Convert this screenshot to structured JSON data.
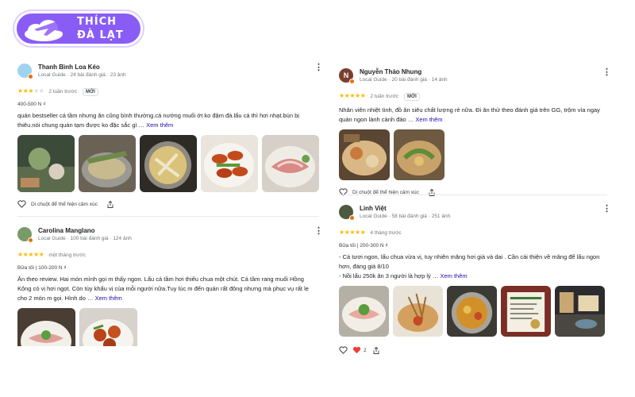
{
  "logo": {
    "line1": "THÍCH",
    "line2": "ĐÀ LẠT"
  },
  "see_more": "Xem thêm",
  "reviews": [
    {
      "name": "Thanh Bình Loa Kéo",
      "meta": "Local Guide · 24 bài đánh giá · 23 ảnh",
      "stars_on": "★★★",
      "stars_off": "★★",
      "ago": "2 tuần trước",
      "badge": "MỚI",
      "price": "400-500 N ₫",
      "text": "quán bestseller cá tầm nhưng ăn cũng bình thường.cá nướng muối ớt ko đậm đà.lẩu cá thì hơi nhạt.bún bị thiêu.nói chung quán tạm được ko đặc sắc gì …",
      "react": "Di chuột để thể hiện cảm xúc"
    },
    {
      "name": "Carolina Manglano",
      "meta": "Local Guide · 100 bài đánh giá · 124 ảnh",
      "stars_on": "★★★★★",
      "stars_off": "",
      "ago": "một tháng trước",
      "price": "Bữa tối  |  100-200 N ₫",
      "text": "Ăn theo review. Hai món mình gọi m thấy ngon. Lẩu cá tầm hơi thiếu chua một chút. Cá tầm rang muối Hồng Kông có vị hơi ngọt. Còn tùy khẩu vị của mỗi người nữa.Tuy lúc m đến quán rất đông nhưng mà phục vụ rất lẹ cho 2 món m gọi. Hình do …"
    },
    {
      "name": "Nguyễn Thảo Nhung",
      "meta": "Local Guide · 20 bài đánh giá · 14 ảnh",
      "avatar_letter": "N",
      "stars_on": "★★★★★",
      "stars_off": "",
      "ago": "2 tuần trước",
      "badge": "MỚI",
      "text": "Nhân viên nhiệt tình, đồ ăn siêu chất lượng rẻ nữa. Đi ăn thử theo đánh giá trên GG, trộm vía ngay quán ngon lành cành đào …",
      "react": "Di chuột để thể hiện cảm xúc"
    },
    {
      "name": "Linh Việt",
      "meta": "Local Guide · 58 bài đánh giá · 251 ảnh",
      "stars_on": "★★★★★",
      "stars_off": "",
      "ago": "4 tháng trước",
      "price": "Bữa tối  |  200-300 N ₫",
      "text1": "- Cá tươi ngon, lẩu chua vừa vị, tuy nhiên măng hơi già và dai . Cần cải thiện về măng để lẩu ngon hơn, đáng giá 8/10",
      "text2": "- Nồi lẩu 250k ăn 3 người là hợp lý …",
      "react_count": "2"
    }
  ],
  "colors": {
    "logo": "#8a5cf6",
    "star": "#fbbc04",
    "link": "#1a0dab",
    "local_guide_badge": "#e8710a"
  }
}
